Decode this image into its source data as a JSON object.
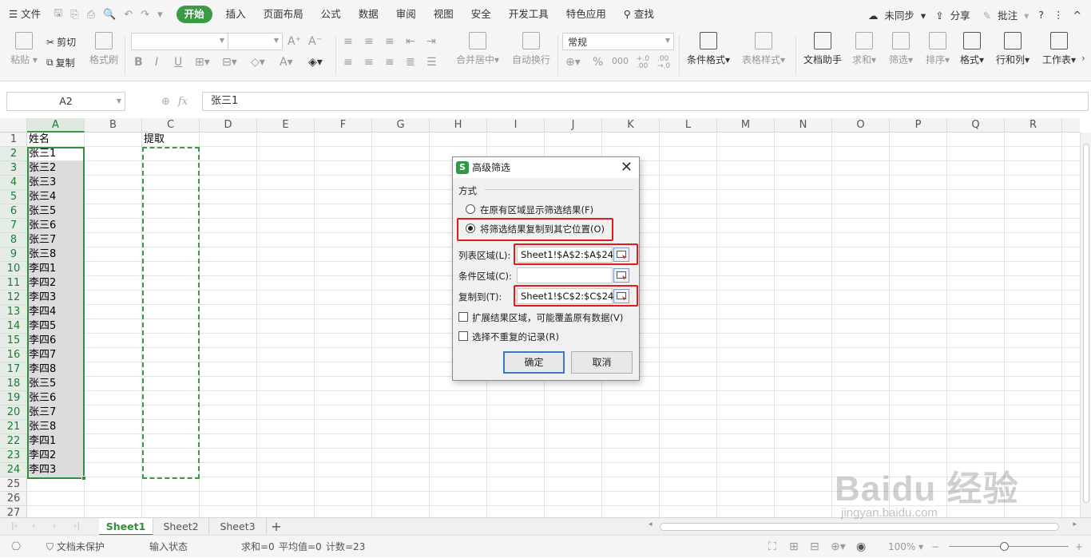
{
  "menubar": {
    "file": "文件",
    "tabs": [
      "开始",
      "插入",
      "页面布局",
      "公式",
      "数据",
      "审阅",
      "视图",
      "安全",
      "开发工具",
      "特色应用"
    ],
    "active_tab": "开始",
    "search": "查找",
    "sync": "未同步",
    "share": "分享",
    "comment": "批注",
    "help": "?",
    "more": "⋮",
    "collapse": "^"
  },
  "ribbon": {
    "paste": "粘贴",
    "cut": "剪切",
    "copy": "复制",
    "format_painter": "格式刷",
    "number_format": "常规",
    "merge_center": "合并居中",
    "wrap_text": "自动换行",
    "conditional_format": "条件格式",
    "table_style": "表格样式",
    "doc_assistant": "文档助手",
    "sum": "求和",
    "filter": "筛选",
    "sort": "排序",
    "format": "格式",
    "row_col": "行和列",
    "worksheet": "工作表",
    "bold": "B",
    "italic": "I",
    "underline": "U",
    "percent": "%",
    "font_size_up": "A⁺",
    "font_size_down": "A⁻",
    "dec_inc": "+.0 .00",
    "dec_dec": ".00 →.0"
  },
  "formula_bar": {
    "name_box": "A2",
    "fx": "fx",
    "content": "张三1"
  },
  "grid": {
    "columns": [
      "A",
      "B",
      "C",
      "D",
      "E",
      "F",
      "G",
      "H",
      "I",
      "J",
      "K",
      "L",
      "M",
      "N",
      "O",
      "P",
      "Q",
      "R"
    ],
    "rows": [
      "1",
      "2",
      "3",
      "4",
      "5",
      "6",
      "7",
      "8",
      "9",
      "10",
      "11",
      "12",
      "13",
      "14",
      "15",
      "16",
      "17",
      "18",
      "19",
      "20",
      "21",
      "22",
      "23",
      "24",
      "25",
      "26",
      "27"
    ],
    "a1": "姓名",
    "c1": "提取",
    "column_a": [
      "张三1",
      "张三2",
      "张三3",
      "张三4",
      "张三5",
      "张三6",
      "张三7",
      "张三8",
      "李四1",
      "李四2",
      "李四3",
      "李四4",
      "李四5",
      "李四6",
      "李四7",
      "李四8",
      "张三5",
      "张三6",
      "张三7",
      "张三8",
      "李四1",
      "李四2",
      "李四3"
    ]
  },
  "sheets": [
    "Sheet1",
    "Sheet2",
    "Sheet3"
  ],
  "add_sheet": "+",
  "status": {
    "doc_protect": "文档未保护",
    "input_state": "输入状态",
    "sum": "求和=0",
    "average": "平均值=0",
    "count": "计数=23",
    "zoom": "100%"
  },
  "dialog": {
    "title": "高级筛选",
    "section": "方式",
    "option1": "在原有区域显示筛选结果(F)",
    "option2": "将筛选结果复制到其它位置(O)",
    "list_range_label": "列表区域(L):",
    "list_range_value": "Sheet1!$A$2:$A$24",
    "criteria_label": "条件区域(C):",
    "criteria_value": "",
    "copy_to_label": "复制到(T):",
    "copy_to_value": "Sheet1!$C$2:$C$24",
    "expand_label": "扩展结果区域，可能覆盖原有数据(V)",
    "unique_label": "选择不重复的记录(R)",
    "ok": "确定",
    "cancel": "取消"
  },
  "watermark": {
    "main": "Baidu 经验",
    "url": "jingyan.baidu.com"
  }
}
